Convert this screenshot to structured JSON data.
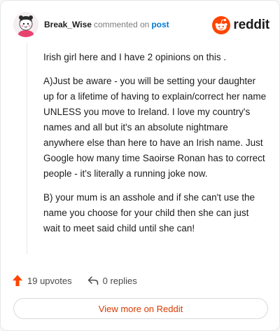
{
  "header": {
    "username": "Break_Wise",
    "commented_on": "commented on",
    "post_link": "post",
    "brand": "reddit"
  },
  "comment": {
    "paragraphs": [
      "Irish girl here and I have 2 opinions on this .",
      "A)Just be aware - you will be setting your daughter up for a lifetime of having to explain/correct her name UNLESS you move to Ireland. I love my country's names and all but it's an absolute nightmare anywhere else than here to have an Irish name. Just Google how many time Saoirse Ronan has to correct people - it's literally a running joke now.",
      "B) your mum is an asshole and if she can't use the name you choose for your child then she can just wait to meet said child until she can!"
    ]
  },
  "actions": {
    "upvotes": "19 upvotes",
    "replies": "0 replies"
  },
  "footer": {
    "view_more": "View more on Reddit"
  },
  "colors": {
    "brand_orange": "#ff4500",
    "link_blue": "#0079d3",
    "cta_red": "#d93a00"
  }
}
